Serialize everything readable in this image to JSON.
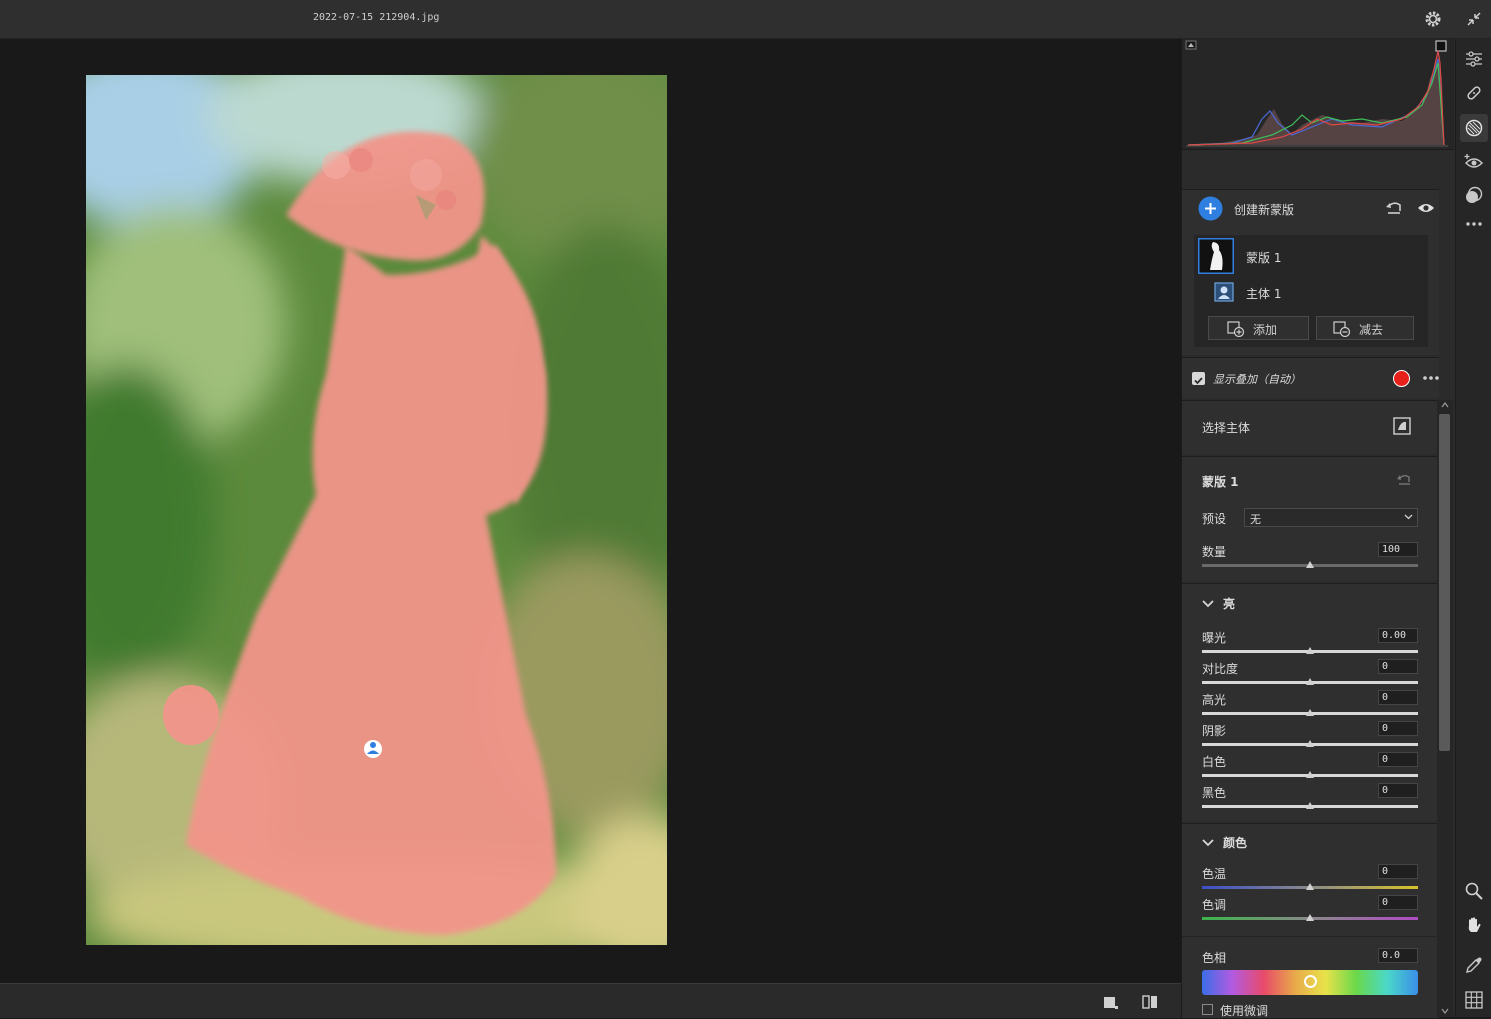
{
  "window": {
    "filename": "2022-07-15 212904.jpg"
  },
  "colors": {
    "accent": "#2f7fe0",
    "overlay": "#e8201a",
    "photo_tint": "#f39a8a"
  },
  "top_icons": [
    "gear-icon",
    "collapse-icon"
  ],
  "tools": [
    "sliders-icon",
    "heal-icon",
    "mask-icon",
    "redeye-icon",
    "presets-icon",
    "more-icon",
    "zoom-icon",
    "hand-icon",
    "eyedropper-icon",
    "grid-icon"
  ],
  "masks": {
    "create_label": "创建新蒙版",
    "mask_name": "蒙版 1",
    "component_name": "主体 1",
    "add_label": "添加",
    "subtract_label": "减去",
    "show_overlay_label": "显示叠加（自动）",
    "show_overlay_checked": true
  },
  "select_subject": {
    "label": "选择主体"
  },
  "mask_panel": {
    "title": "蒙版 1",
    "preset_label": "预设",
    "preset_value": "无",
    "amount_label": "数量",
    "amount_value": "100",
    "amount_level": 0.5
  },
  "light": {
    "title": "亮",
    "sliders": [
      {
        "label": "曝光",
        "value": "0.00",
        "level": 0.5
      },
      {
        "label": "对比度",
        "value": "0",
        "level": 0.5
      },
      {
        "label": "高光",
        "value": "0",
        "level": 0.5
      },
      {
        "label": "阴影",
        "value": "0",
        "level": 0.5
      },
      {
        "label": "白色",
        "value": "0",
        "level": 0.5
      },
      {
        "label": "黑色",
        "value": "0",
        "level": 0.5
      }
    ]
  },
  "color": {
    "title": "颜色",
    "temp_label": "色温",
    "temp_value": "0",
    "temp_level": 0.5,
    "tint_label": "色调",
    "tint_value": "0",
    "tint_level": 0.5,
    "hue_label": "色相",
    "hue_value": "0.0",
    "hue_level": 0.5,
    "fine_tune_label": "使用微调"
  }
}
